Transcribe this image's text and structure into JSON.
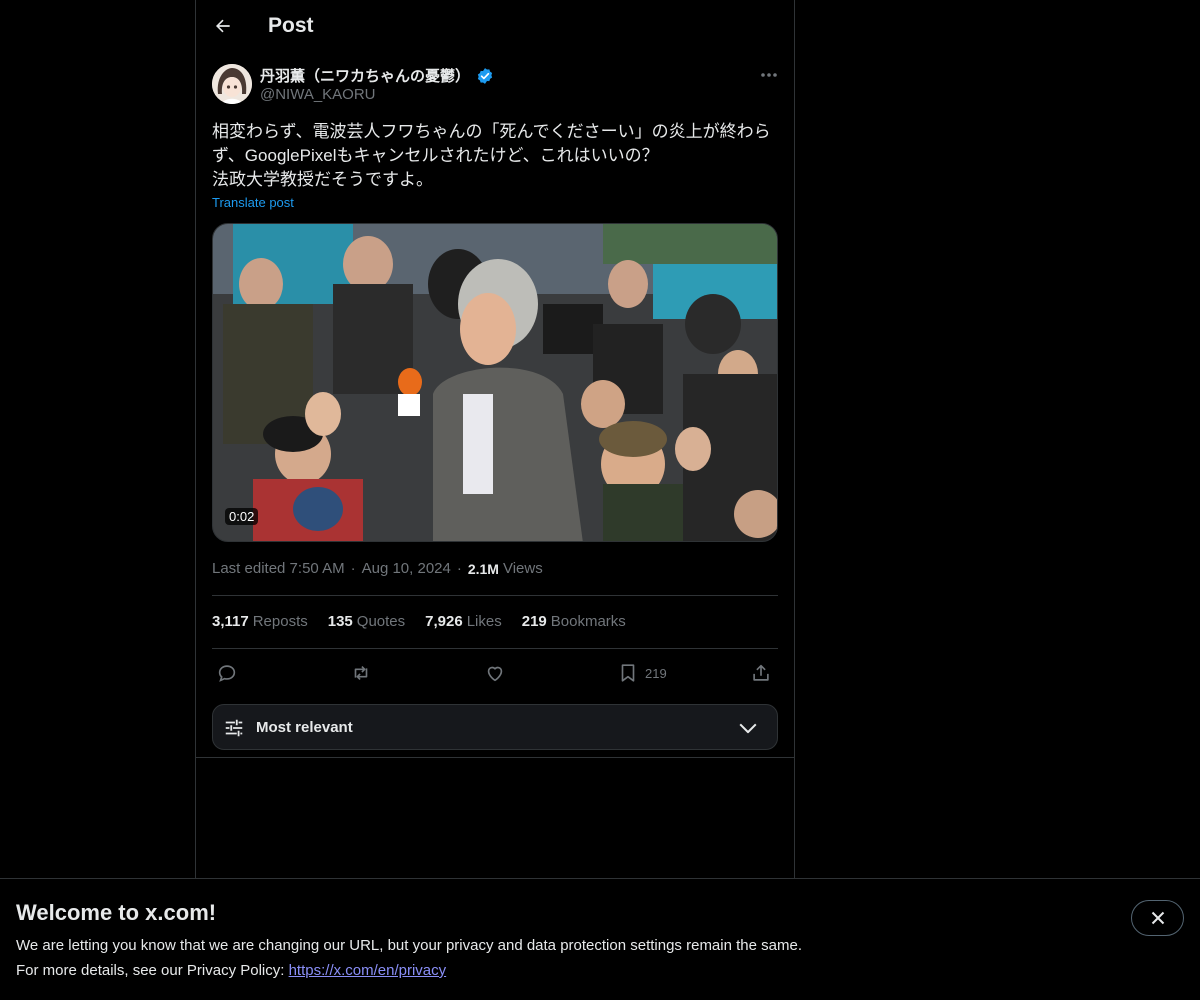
{
  "header": {
    "title": "Post"
  },
  "post": {
    "author_name": "丹羽薫（ニワカちゃんの憂鬱）",
    "author_handle": "@NIWA_KAORU",
    "text": "相変わらず、電波芸人フワちゃんの「死んでくださーい」の炎上が終わらず、GooglePixelもキャンセルされたけど、これはいいの？\n法政大学教授だそうですよ。",
    "translate_label": "Translate post",
    "video_duration": "0:02",
    "meta": {
      "edited_label": "Last edited 7:50 AM",
      "separator": "·",
      "date": "Aug 10, 2024",
      "views_count": "2.1M",
      "views_label": "Views"
    },
    "stats": [
      {
        "count": "3,117",
        "label": "Reposts"
      },
      {
        "count": "135",
        "label": "Quotes"
      },
      {
        "count": "7,926",
        "label": "Likes"
      },
      {
        "count": "219",
        "label": "Bookmarks"
      }
    ],
    "actions": {
      "reply_icon": "reply-icon",
      "repost_icon": "repost-icon",
      "like_icon": "heart-icon",
      "bookmark_icon": "bookmark-icon",
      "bookmark_count": "219",
      "share_icon": "share-icon"
    }
  },
  "sort": {
    "label": "Most relevant"
  },
  "banner": {
    "title": "Welcome to x.com!",
    "line1": "We are letting you know that we are changing our URL, but your privacy and data protection settings remain the same.",
    "line2_prefix": "For more details, see our Privacy Policy: ",
    "link": "https://x.com/en/privacy"
  },
  "colors": {
    "background": "#000000",
    "text": "#e7e9ea",
    "muted": "#71767b",
    "accent": "#1d9bf0",
    "border": "#2f3336",
    "link": "#8a8ff7"
  }
}
